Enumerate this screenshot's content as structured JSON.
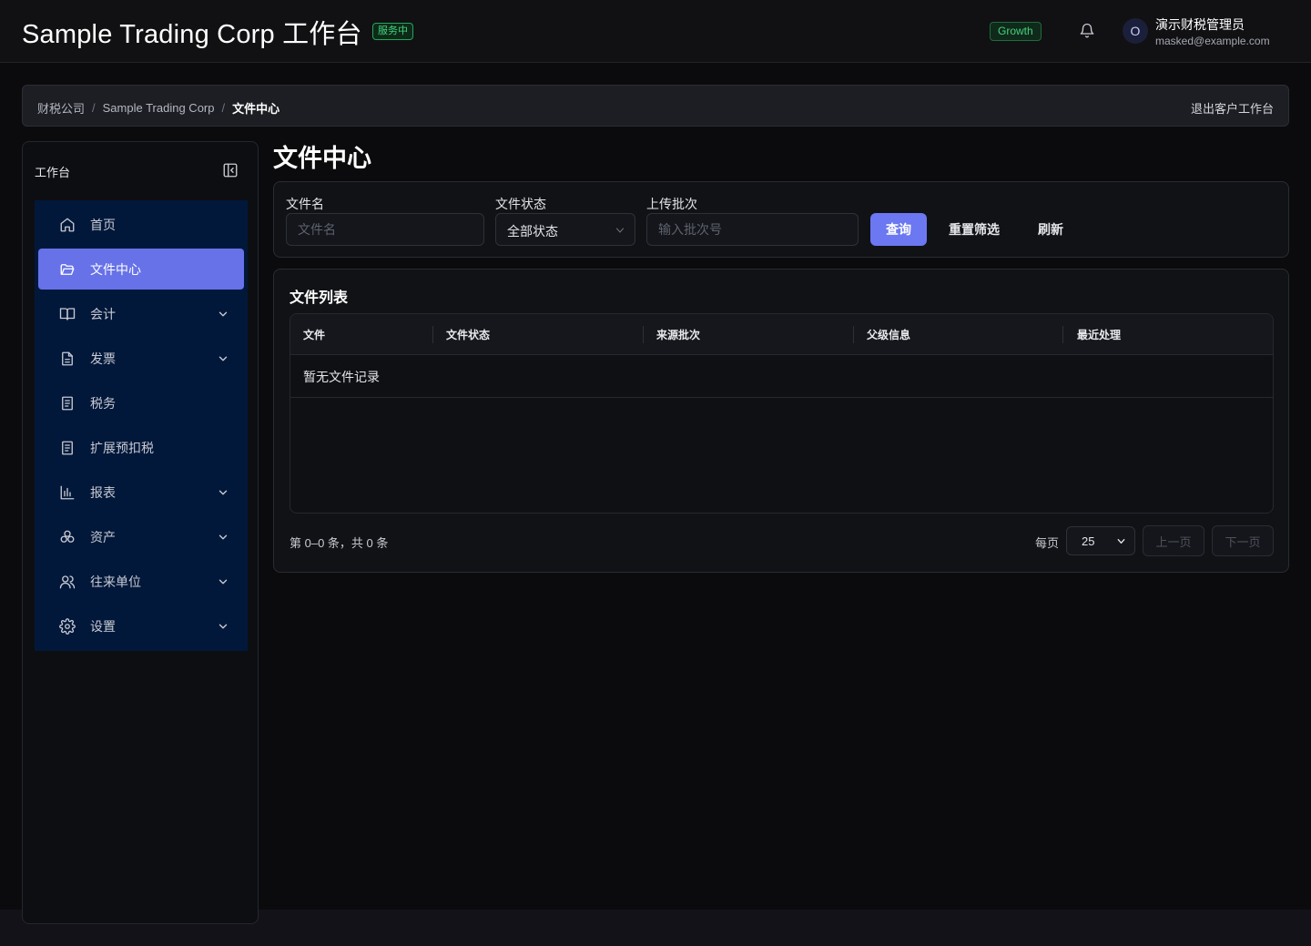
{
  "header": {
    "title": "Sample Trading Corp 工作台",
    "service_badge": "服务中",
    "plan_badge": "Growth",
    "user": {
      "avatar_initial": "O",
      "name": "演示财税管理员",
      "email": "masked@example.com"
    }
  },
  "breadcrumb": {
    "items": [
      "财税公司",
      "Sample Trading Corp",
      "文件中心"
    ],
    "exit_label": "退出客户工作台"
  },
  "sidebar": {
    "title": "工作台",
    "items": [
      {
        "label": "首页",
        "icon": "home-icon",
        "active": false,
        "expandable": false
      },
      {
        "label": "文件中心",
        "icon": "folder-open-icon",
        "active": true,
        "expandable": false
      },
      {
        "label": "会计",
        "icon": "book-icon",
        "active": false,
        "expandable": true
      },
      {
        "label": "发票",
        "icon": "document-icon",
        "active": false,
        "expandable": true
      },
      {
        "label": "税务",
        "icon": "receipt-icon",
        "active": false,
        "expandable": false
      },
      {
        "label": "扩展预扣税",
        "icon": "receipt-icon",
        "active": false,
        "expandable": false
      },
      {
        "label": "报表",
        "icon": "bar-chart-icon",
        "active": false,
        "expandable": true
      },
      {
        "label": "资产",
        "icon": "boxes-icon",
        "active": false,
        "expandable": true
      },
      {
        "label": "往来单位",
        "icon": "users-icon",
        "active": false,
        "expandable": true
      },
      {
        "label": "设置",
        "icon": "gear-icon",
        "active": false,
        "expandable": true
      }
    ]
  },
  "page": {
    "title": "文件中心"
  },
  "filters": {
    "filename_label": "文件名",
    "filename_placeholder": "文件名",
    "filename_value": "",
    "status_label": "文件状态",
    "status_value": "全部状态",
    "batch_label": "上传批次",
    "batch_placeholder": "输入批次号",
    "batch_value": "",
    "query_label": "查询",
    "reset_label": "重置筛选",
    "refresh_label": "刷新"
  },
  "file_list": {
    "title": "文件列表",
    "columns": [
      "文件",
      "文件状态",
      "来源批次",
      "父级信息",
      "最近处理"
    ],
    "empty_text": "暂无文件记录",
    "summary": "第 0–0 条，共 0 条",
    "per_page_label": "每页",
    "per_page_value": "25",
    "prev_label": "上一页",
    "next_label": "下一页"
  },
  "colors": {
    "accent": "#6772e8",
    "sidebar_nav_bg": "#02183a",
    "badge_green": "#43d17f",
    "page_bg": "#0b0b0d"
  }
}
